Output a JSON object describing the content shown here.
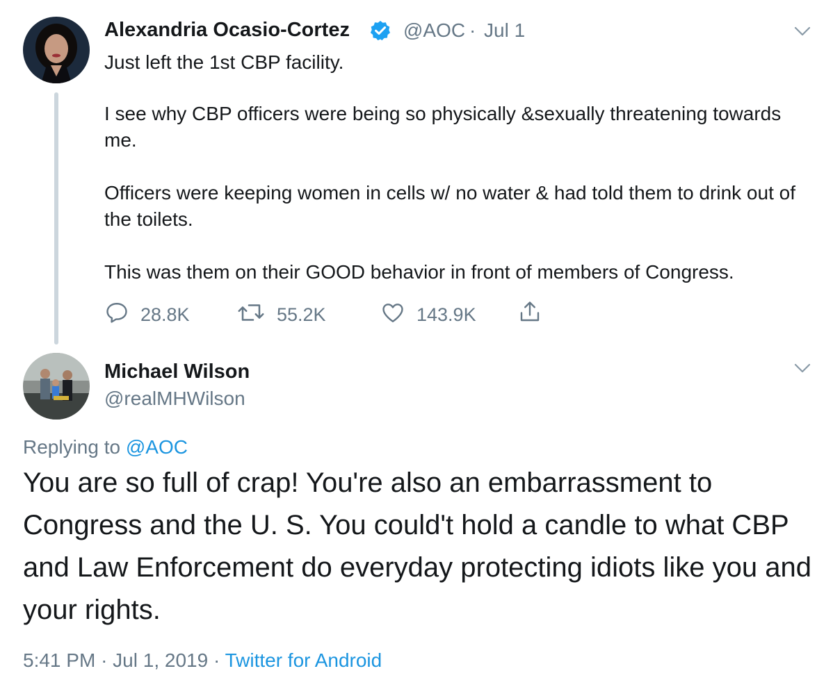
{
  "original_tweet": {
    "author_name": "Alexandria Ocasio-Cortez",
    "handle": "@AOC",
    "separator": "·",
    "date": "Jul 1",
    "verified_icon": "verified-badge-icon",
    "paragraphs": [
      "Just left the 1st CBP facility.",
      "I see why CBP officers were being so physically &sexually threatening towards me.",
      "Officers were keeping women in cells w/ no water & had told them to drink out of the toilets.",
      "This was them on their GOOD behavior in front of members of Congress."
    ],
    "actions": {
      "replies": "28.8K",
      "retweets": "55.2K",
      "likes": "143.9K"
    }
  },
  "reply_tweet": {
    "author_name": "Michael Wilson",
    "handle": "@realMHWilson",
    "replying_prefix": "Replying to",
    "replying_to": "@AOC",
    "text": "You are so full of crap! You're also an embarrassment to Congress and the U. S. You could't hold a candle to what CBP and Law Enforcement do everyday protecting idiots like you and your rights.",
    "time": "5:41 PM",
    "separator": "·",
    "full_date": "Jul 1, 2019",
    "source": "Twitter for Android"
  },
  "colors": {
    "text": "#14171a",
    "muted": "#657786",
    "link": "#1b95e0",
    "verified": "#1da1f2",
    "thread_line": "#ccd6dd"
  }
}
